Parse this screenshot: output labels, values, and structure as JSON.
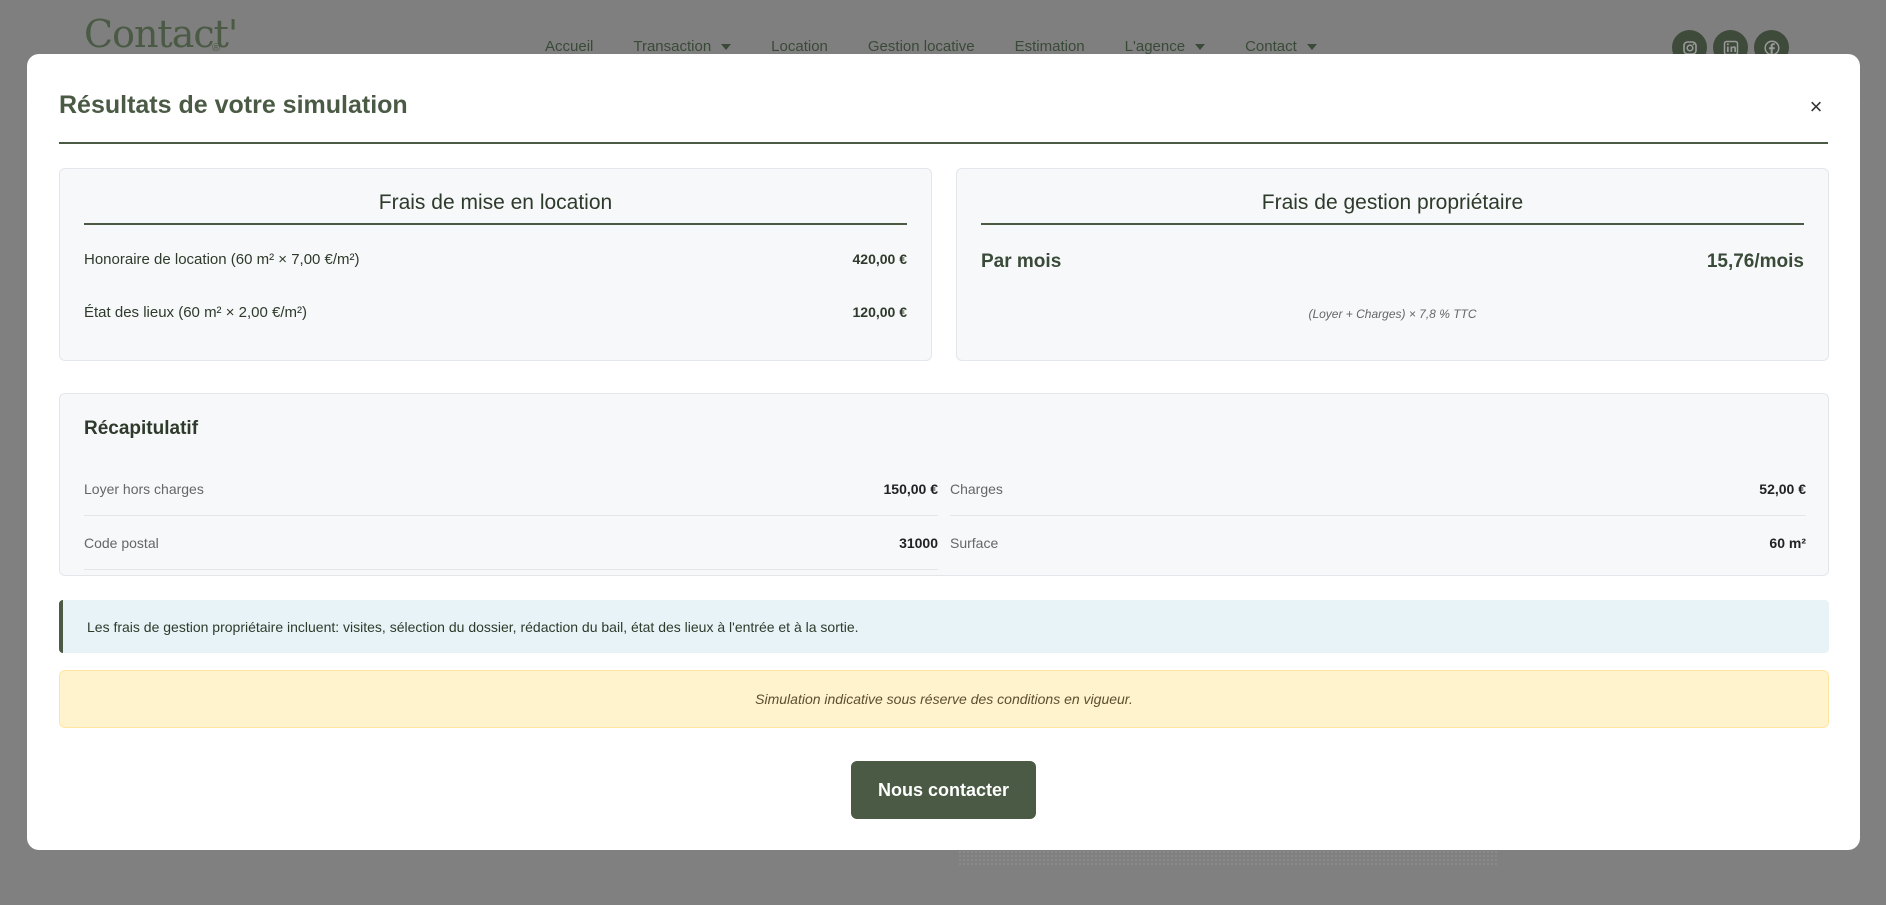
{
  "site": {
    "logo_text": "Contact'",
    "nav": [
      {
        "label": "Accueil",
        "dropdown": false
      },
      {
        "label": "Transaction",
        "dropdown": true
      },
      {
        "label": "Location",
        "dropdown": false
      },
      {
        "label": "Gestion locative",
        "dropdown": false
      },
      {
        "label": "Estimation",
        "dropdown": false
      },
      {
        "label": "L'agence",
        "dropdown": true
      },
      {
        "label": "Contact",
        "dropdown": true
      }
    ],
    "socials": [
      "instagram-icon",
      "linkedin-icon",
      "facebook-icon"
    ]
  },
  "modal": {
    "title": "Résultats de votre simulation",
    "close_glyph": "×",
    "mise_en_location": {
      "title": "Frais de mise en location",
      "rows": [
        {
          "label": "Honoraire de location (60 m² × 7,00 €/m²)",
          "value": "420,00 €"
        },
        {
          "label": "État des lieux (60 m² × 2,00 €/m²)",
          "value": "120,00 €"
        }
      ]
    },
    "gestion": {
      "title": "Frais de gestion propriétaire",
      "period_label": "Par mois",
      "amount": "15,76/mois",
      "formula": "(Loyer + Charges) × 7,8 % TTC"
    },
    "recap": {
      "title": "Récapitulatif",
      "items": [
        {
          "label": "Loyer hors charges",
          "value": "150,00 €"
        },
        {
          "label": "Charges",
          "value": "52,00 €"
        },
        {
          "label": "Code postal",
          "value": "31000"
        },
        {
          "label": "Surface",
          "value": "60 m²"
        }
      ]
    },
    "info_text": "Les frais de gestion propriétaire incluent: visites, sélection du dossier, rédaction du bail, état des lieux à l'entrée et à la sortie.",
    "warning_text": "Simulation indicative sous réserve des conditions en vigueur.",
    "contact_button": "Nous contacter"
  },
  "colors": {
    "accent": "#4a5a44",
    "overlay": "#808080",
    "info_bg": "#e8f3f7",
    "warning_bg": "#fff3cd"
  }
}
